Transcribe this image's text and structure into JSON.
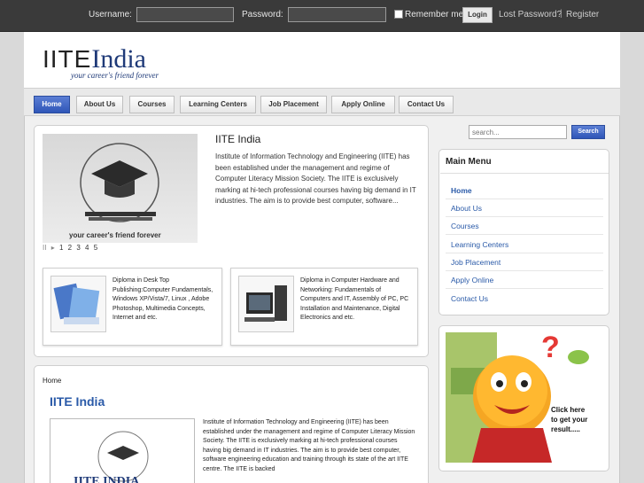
{
  "login": {
    "username_label": "Username:",
    "password_label": "Password:",
    "remember_label": "Remember me",
    "login_button": "Login",
    "lost_password": "Lost Password?",
    "separator": "|",
    "register": "Register"
  },
  "brand": {
    "logo_prefix": "IITE",
    "logo_suffix": "India",
    "tagline": "your career's friend forever"
  },
  "nav": [
    {
      "label": "Home",
      "active": true
    },
    {
      "label": "About Us"
    },
    {
      "label": "Courses"
    },
    {
      "label": "Learning Centers"
    },
    {
      "label": "Job Placement"
    },
    {
      "label": "Apply Online"
    },
    {
      "label": "Contact Us"
    }
  ],
  "slider": {
    "caption": "your career's friend forever",
    "controls": [
      "II",
      "▸",
      "1",
      "2",
      "3",
      "4",
      "5"
    ]
  },
  "featured": {
    "title": "IITE India",
    "text": "Institute of Information Technology and Engineering (IITE) has been established under the management and regime of Computer Literacy Mission Society. The IITE is exclusively marking at hi-tech professional courses having big demand in IT industries. The aim is to provide best computer, software..."
  },
  "courses": [
    {
      "text": "Diploma in Desk Top Publishing:Computer Fundamentals, Windows XP/Vista/7, Linux , Adobe Photoshop, Multimedia Concepts, Internet and etc."
    },
    {
      "text": "Diploma in Computer Hardware and Networking: Fundamentals of Computers and IT, Assembly of PC, PC Installation and Maintenance, Digital Electronics and etc."
    }
  ],
  "article": {
    "breadcrumb": "Home",
    "title": "IITE India",
    "image_text": "IITE INDIA",
    "text": "Institute of Information Technology and Engineering (IITE) has been established under the management and regime of Computer Literacy Mission Society. The IITE is exclusively marking at hi-tech professional courses having big demand in IT industries. The aim is to provide best computer, software engineering education and training through its state of the art IITE centre. The IITE is backed"
  },
  "search": {
    "placeholder": "search...",
    "button": "Search"
  },
  "main_menu": {
    "title": "Main Menu",
    "items": [
      "Home",
      "About Us",
      "Courses",
      "Learning Centers",
      "Job Placement",
      "Apply Online",
      "Contact Us"
    ]
  },
  "promo": {
    "line1": "Click here",
    "line2": "to get your",
    "line3": "result....."
  },
  "colors": {
    "accent": "#2f56b8",
    "link": "#2a5aa8",
    "topbar": "#3a3a3a"
  }
}
